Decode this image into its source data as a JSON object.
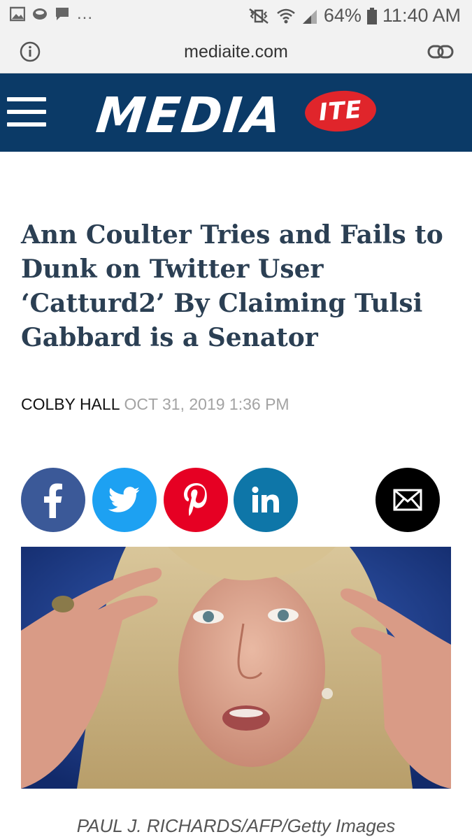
{
  "status_bar": {
    "battery": "64%",
    "time": "11:40 AM",
    "overflow": "..."
  },
  "browser": {
    "url": "mediaite.com"
  },
  "site": {
    "logo_main": "MEDIA",
    "logo_badge": "ITE"
  },
  "article": {
    "headline": "Ann Coulter Tries and Fails to Dunk on Twitter User ‘Catturd2’ By Claiming Tulsi Gabbard is a Senator",
    "author": "COLBY HALL",
    "date": "OCT 31, 2019 1:36 PM",
    "image_credit": "PAUL J. RICHARDS/AFP/Getty Images"
  },
  "share": [
    "facebook-icon",
    "twitter-icon",
    "pinterest-icon",
    "linkedin-icon",
    "email-icon"
  ],
  "colors": {
    "header_bg": "#0b3a67",
    "headline": "#2b3f53",
    "brand_red": "#e0252b",
    "facebook": "#3b5998",
    "twitter": "#1da1f2",
    "pinterest": "#e60023",
    "linkedin": "#0e76a8"
  }
}
